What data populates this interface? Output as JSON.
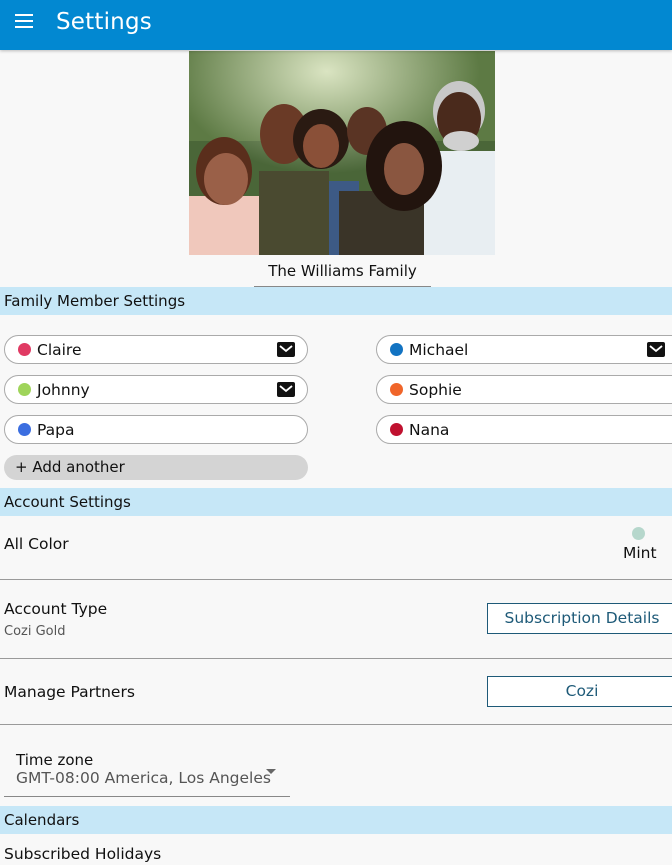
{
  "appbar": {
    "title": "Settings",
    "menu_icon": "hamburger-menu-icon"
  },
  "family": {
    "photo_alt": "Family photo",
    "name": "The Williams Family"
  },
  "sections": {
    "family_members": "Family Member Settings",
    "account": "Account Settings",
    "calendars": "Calendars"
  },
  "members": [
    {
      "name": "Claire",
      "color": "#e03a63",
      "has_email": true
    },
    {
      "name": "Michael",
      "color": "#1273c2",
      "has_email": true
    },
    {
      "name": "Johnny",
      "color": "#9fd45a",
      "has_email": true
    },
    {
      "name": "Sophie",
      "color": "#f0652a",
      "has_email": false
    },
    {
      "name": "Papa",
      "color": "#3b6ee0",
      "has_email": false
    },
    {
      "name": "Nana",
      "color": "#c0112f",
      "has_email": false
    }
  ],
  "add_another_label": "+ Add another",
  "account": {
    "all_color_label": "All Color",
    "all_color_value": "Mint",
    "all_color_hex": "#b6d7cc",
    "account_type_label": "Account Type",
    "account_type_value": "Cozi Gold",
    "subscription_button": "Subscription Details",
    "manage_partners_label": "Manage Partners",
    "partners_button": "Cozi",
    "timezone_label": "Time zone",
    "timezone_value": "GMT-08:00 America, Los Angeles"
  },
  "calendars": {
    "subscribed_holidays_label": "Subscribed Holidays"
  },
  "colors": {
    "appbar": "#0288d1",
    "section_header": "#c6e7f7",
    "button_border": "#1e5a78"
  }
}
